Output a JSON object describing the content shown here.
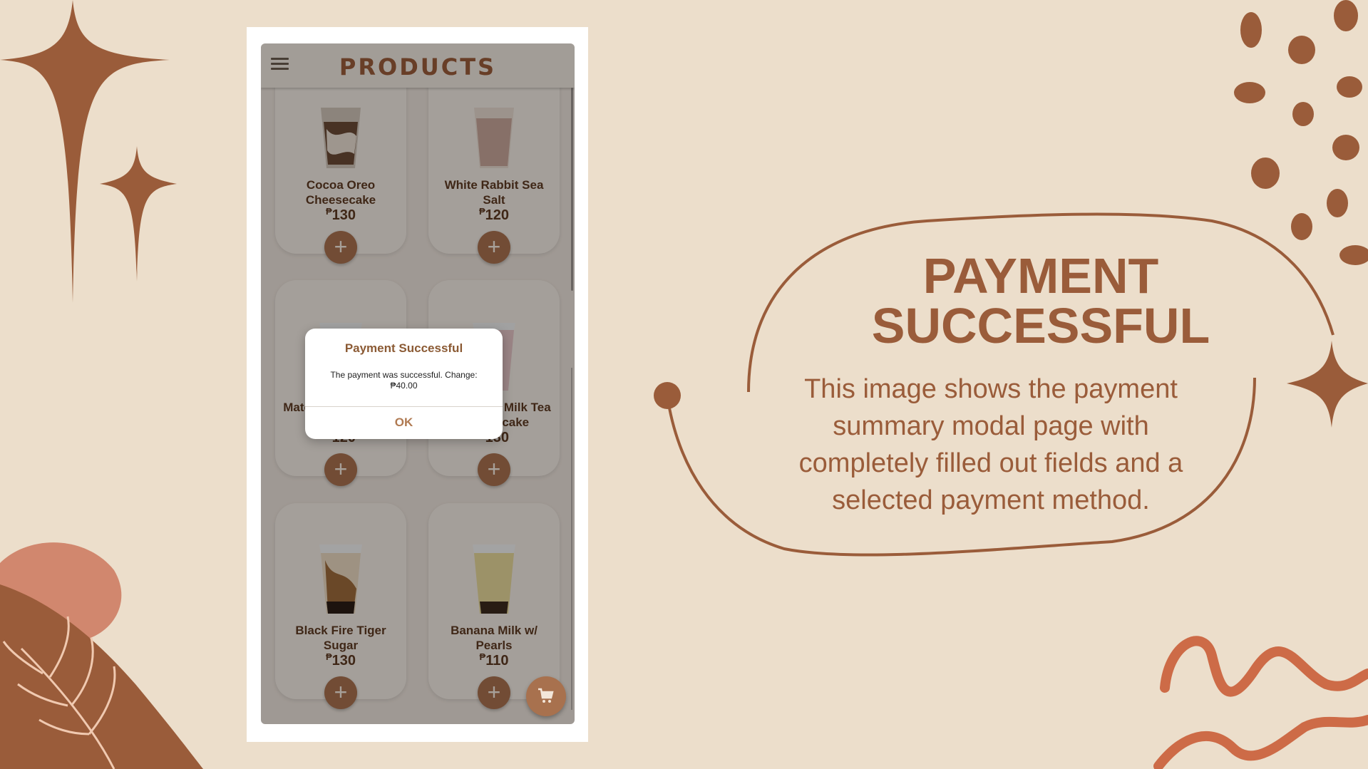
{
  "app": {
    "title": "PRODUCTS",
    "menu_icon": "hamburger-menu-icon",
    "cart_icon": "shopping-cart-icon"
  },
  "products": [
    {
      "name": "Cocoa Oreo Cheesecake",
      "currency": "₱",
      "price": "130",
      "add_label": "+"
    },
    {
      "name": "White Rabbit Sea Salt",
      "currency": "₱",
      "price": "120",
      "add_label": "+"
    },
    {
      "name": "Matcha Cheesecake",
      "currency": "₱",
      "price": "120",
      "add_label": "+"
    },
    {
      "name": "Strawberry Milk Tea Cheesecake",
      "currency": "₱",
      "price": "130",
      "add_label": "+"
    },
    {
      "name": "Black Fire Tiger Sugar",
      "currency": "₱",
      "price": "130",
      "add_label": "+"
    },
    {
      "name": "Banana Milk w/ Pearls",
      "currency": "₱",
      "price": "110",
      "add_label": "+"
    }
  ],
  "modal": {
    "title": "Payment Successful",
    "message": "The payment was successful. Change: ₱40.00",
    "ok_label": "OK"
  },
  "slide": {
    "title_line1": "PAYMENT",
    "title_line2": "SUCCESSFUL",
    "description": "This image shows the payment summary modal page with completely filled out fields and a selected payment method."
  },
  "colors": {
    "accent": "#9a5c3a",
    "background": "#ecdecb",
    "button": "#a8714e"
  }
}
